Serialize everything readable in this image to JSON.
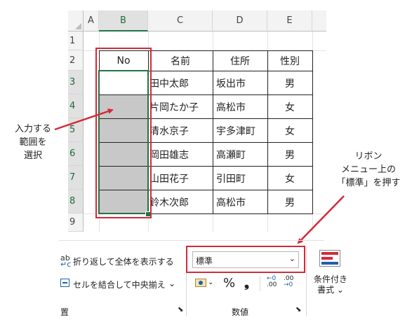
{
  "spreadsheet": {
    "columns": [
      "A",
      "B",
      "C",
      "D",
      "E"
    ],
    "rows": [
      "1",
      "2",
      "3",
      "4",
      "5",
      "6",
      "7",
      "8",
      "9"
    ],
    "headers": {
      "no": "No",
      "name": "名前",
      "address": "住所",
      "gender": "性別"
    },
    "records": [
      {
        "name": "田中太郎",
        "address": "坂出市",
        "gender": "男"
      },
      {
        "name": "片岡たか子",
        "address": "高松市",
        "gender": "女"
      },
      {
        "name": "清水京子",
        "address": "宇多津町",
        "gender": "女"
      },
      {
        "name": "岡田雄志",
        "address": "高瀬町",
        "gender": "男"
      },
      {
        "name": "山田花子",
        "address": "引田町",
        "gender": "女"
      },
      {
        "name": "鈴木次郎",
        "address": "高松市",
        "gender": "男"
      }
    ]
  },
  "annotations": {
    "input_range": [
      "入力する",
      "範囲を",
      "選択"
    ],
    "ribbon_hint": [
      "リボン",
      "メニュー上の",
      "「標準」を押す"
    ]
  },
  "ribbon": {
    "wrap_text": "折り返して全体を表示する",
    "merge_center": "セルを結合して中央揃え",
    "align_group": "置",
    "number_group": "数値",
    "number_format": "標準",
    "percent": "%",
    "comma": "❟",
    "inc_decimal": ".00",
    "dec_decimal": ".00",
    "cond_format": [
      "条件付き",
      "書式 ⌄"
    ]
  },
  "colors": {
    "accent_red": "#d42a38",
    "excel_green": "#217346",
    "selection_gray": "#c8c8c8"
  }
}
